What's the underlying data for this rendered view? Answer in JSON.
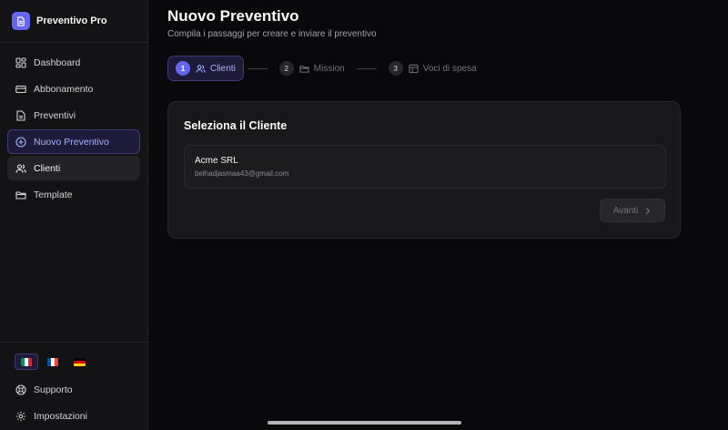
{
  "app": {
    "name": "Preventivo Pro",
    "logo_icon": "document-icon",
    "accent": "#6366f1"
  },
  "sidebar": {
    "items": [
      {
        "label": "Dashboard",
        "icon": "dashboard-icon"
      },
      {
        "label": "Abbonamento",
        "icon": "card-icon"
      },
      {
        "label": "Preventivi",
        "icon": "document-icon"
      },
      {
        "label": "Nuovo Preventivo",
        "icon": "plus-circle-icon",
        "state": "active"
      },
      {
        "label": "Clienti",
        "icon": "users-icon",
        "state": "hover"
      },
      {
        "label": "Template",
        "icon": "folder-icon"
      }
    ],
    "languages": [
      {
        "code": "it",
        "name": "Italiano",
        "selected": true
      },
      {
        "code": "fr",
        "name": "Français",
        "selected": false
      },
      {
        "code": "de",
        "name": "Deutsch",
        "selected": false
      }
    ],
    "bottom_items": [
      {
        "label": "Supporto",
        "icon": "lifebuoy-icon"
      },
      {
        "label": "Impostazioni",
        "icon": "gear-icon"
      }
    ]
  },
  "page": {
    "title": "Nuovo Preventivo",
    "subtitle": "Compila i passaggi per creare e inviare il preventivo"
  },
  "stepper": {
    "steps": [
      {
        "number": "1",
        "label": "Clienti",
        "icon": "users-icon",
        "active": true
      },
      {
        "number": "2",
        "label": "Mission",
        "icon": "folder-icon",
        "active": false
      },
      {
        "number": "3",
        "label": "Voci di spesa",
        "icon": "table-icon",
        "active": false
      }
    ]
  },
  "card": {
    "title": "Seleziona il Cliente",
    "client": {
      "name": "Acme SRL",
      "email": "belhadjasmaa43@gmail.com"
    },
    "next_label": "Avanti",
    "next_disabled": true
  }
}
